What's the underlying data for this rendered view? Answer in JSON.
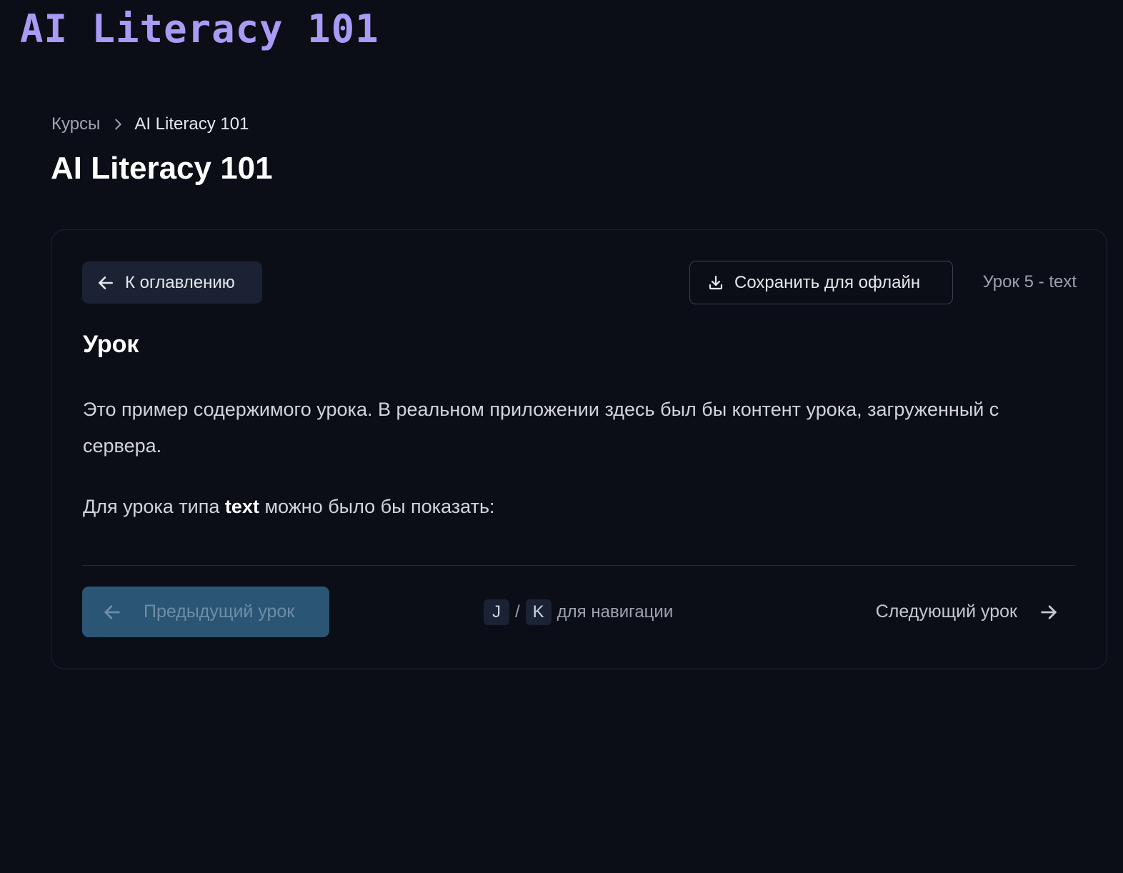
{
  "brand": {
    "logo_text": "AI Literacy 101"
  },
  "breadcrumb": {
    "root": "Курсы",
    "current": "AI Literacy 101"
  },
  "page": {
    "title": "AI Literacy 101"
  },
  "card": {
    "toc_button": "К оглавлению",
    "save_button": "Сохранить для офлайн",
    "lesson_meta": "Урок 5 - text",
    "heading": "Урок",
    "body_paragraph": "Это пример содержимого урока. В реальном приложении здесь был бы контент урока, загруженный с сервера.",
    "body2_prefix": "Для урока типа",
    "body2_bold": "text",
    "body2_suffix": "можно было бы показать:"
  },
  "footer_nav": {
    "prev_button": "Предыдущий урок",
    "next_button": "Следующий урок",
    "key_prev": "J",
    "key_sep": "/",
    "key_next": "K",
    "hint_text": "для навигации"
  },
  "icons": {
    "chevron": "chevron-right-icon",
    "arrow_left": "arrow-left-icon",
    "arrow_right": "arrow-right-icon",
    "download": "download-icon"
  },
  "colors": {
    "background": "#0b0e16",
    "logo": "#a99af5",
    "prev_button_bg": "#2b5574"
  }
}
